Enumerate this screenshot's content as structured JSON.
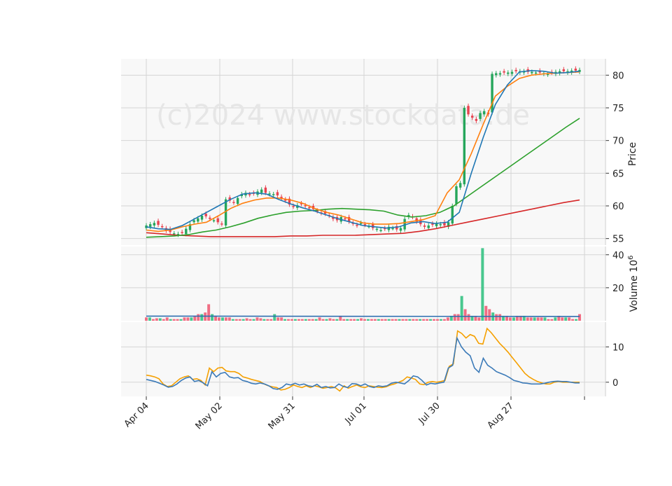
{
  "watermark": "(c)2024 www.stockdata.de",
  "x_tick_labels": [
    "Apr 04",
    "May 02",
    "May 31",
    "Jul 01",
    "Jul 30",
    "Aug 27"
  ],
  "chart_data": [
    {
      "type": "candlestick",
      "panel": "price",
      "ylabel": "Price",
      "ylim": [
        54,
        82.5
      ],
      "yticks": [
        55,
        60,
        65,
        70,
        75,
        80
      ],
      "grid": true,
      "colors": {
        "up": "#26a65b",
        "down": "#e8424f",
        "ma_fast": "#1f77b4",
        "ma_mid": "#ff7f0e",
        "ma_slow": "#2ca02c",
        "ma_long": "#d62728"
      },
      "candles_close": [
        57.0,
        57.2,
        57.4,
        57.1,
        56.8,
        56.2,
        56.0,
        55.8,
        55.7,
        55.9,
        56.5,
        57.2,
        57.8,
        58.1,
        58.5,
        58.4,
        58.0,
        57.8,
        57.5,
        57.2,
        61.0,
        60.8,
        60.5,
        61.2,
        61.8,
        62.0,
        61.7,
        61.9,
        62.2,
        62.5,
        62.0,
        61.9,
        61.8,
        61.6,
        61.2,
        60.8,
        60.2,
        59.9,
        60.1,
        60.3,
        60.0,
        59.7,
        59.5,
        59.2,
        58.9,
        58.8,
        58.5,
        58.0,
        57.8,
        58.3,
        58.0,
        57.6,
        57.3,
        57.0,
        57.4,
        57.1,
        56.9,
        56.6,
        56.5,
        56.3,
        56.5,
        56.8,
        56.6,
        56.4,
        56.6,
        58.0,
        58.6,
        58.3,
        57.6,
        57.2,
        56.8,
        57.0,
        57.1,
        57.3,
        57.2,
        57.0,
        57.5,
        60.0,
        63.0,
        63.5,
        75.0,
        74.0,
        73.5,
        73.0,
        74.2,
        74.5,
        74.0,
        80.2,
        80.3,
        80.3,
        80.4,
        80.4,
        80.5,
        80.6,
        80.6,
        80.6,
        80.5,
        80.5,
        80.4,
        80.4,
        80.3,
        80.2,
        80.4,
        80.5,
        80.6,
        80.6,
        80.6,
        80.7,
        80.7,
        80.8
      ],
      "ma_fast": [
        56.8,
        56.5,
        56.4,
        57.0,
        58.0,
        59.0,
        60.0,
        61.0,
        61.8,
        62.0,
        61.8,
        61.0,
        60.3,
        59.7,
        59.2,
        58.6,
        58.0,
        57.5,
        57.0,
        56.8,
        56.6,
        56.8,
        57.4,
        57.6,
        57.3,
        57.5,
        59.0,
        65.0,
        70.5,
        75.5,
        78.5,
        80.5,
        80.7,
        80.6,
        80.3,
        80.4,
        80.6
      ],
      "ma_mid": [
        56.3,
        56.1,
        56.3,
        56.8,
        57.2,
        57.5,
        58.5,
        59.6,
        60.4,
        60.9,
        61.2,
        61.2,
        60.9,
        60.4,
        59.6,
        59.0,
        58.6,
        58.0,
        57.4,
        57.2,
        57.2,
        57.3,
        57.6,
        57.9,
        58.5,
        62.0,
        64.0,
        68.0,
        72.5,
        76.8,
        78.3,
        79.5,
        80.0,
        80.2,
        80.3,
        80.4,
        80.5
      ],
      "ma_slow": [
        55.2,
        55.3,
        55.4,
        55.6,
        56.0,
        56.3,
        56.8,
        57.4,
        58.1,
        58.6,
        59.0,
        59.2,
        59.3,
        59.5,
        59.6,
        59.5,
        59.4,
        59.2,
        58.6,
        58.3,
        58.5,
        59.0,
        60.0,
        61.5,
        63.0,
        64.5,
        66.0,
        67.5,
        69.0,
        70.5,
        72.0,
        73.4
      ],
      "ma_long": [
        55.9,
        55.7,
        55.5,
        55.4,
        55.3,
        55.3,
        55.3,
        55.3,
        55.3,
        55.4,
        55.4,
        55.5,
        55.5,
        55.5,
        55.6,
        55.7,
        55.8,
        56.1,
        56.5,
        57.0,
        57.5,
        58.0,
        58.5,
        59.0,
        59.5,
        60.0,
        60.5,
        60.9
      ]
    },
    {
      "type": "bar",
      "panel": "volume",
      "ylabel": "Volume 10^6",
      "ylim": [
        0,
        45
      ],
      "yticks": [
        20,
        40
      ],
      "volumes": [
        2,
        2,
        1,
        1.5,
        1.5,
        1,
        2,
        1,
        1,
        1,
        1,
        2,
        2,
        2,
        3,
        4,
        4,
        5,
        10,
        4,
        3,
        2,
        2,
        2,
        2,
        1,
        1,
        1,
        1,
        1.5,
        1,
        1,
        2,
        1.5,
        1,
        1,
        1,
        4,
        2,
        2,
        1,
        1,
        1,
        1,
        1,
        1,
        1,
        1,
        1,
        1,
        2,
        1,
        1,
        1.5,
        1,
        1,
        3,
        1,
        1,
        1,
        1,
        1,
        1.5,
        1,
        1,
        1,
        1,
        1,
        1,
        1,
        1,
        1,
        1,
        1,
        1,
        1,
        1,
        1,
        1,
        1,
        1,
        1,
        1,
        1,
        1,
        1,
        1,
        2,
        3,
        4,
        4,
        15,
        7,
        4,
        3,
        3,
        2,
        44,
        9,
        7,
        5,
        4,
        4,
        3,
        3,
        2,
        2,
        3,
        3,
        3,
        2,
        2,
        2,
        2,
        2,
        2,
        1,
        1,
        2,
        3,
        2,
        2,
        2,
        1,
        1,
        4
      ],
      "avg_volume": 2.8
    },
    {
      "type": "line",
      "panel": "oscillator",
      "ylim": [
        -4,
        17
      ],
      "yticks": [
        0,
        10
      ],
      "series": [
        {
          "color": "#f5a000",
          "values": [
            2.0,
            1.8,
            1.5,
            1.0,
            -0.5,
            -1.2,
            -1.0,
            0.0,
            1.0,
            1.5,
            1.8,
            0.8,
            1.0,
            0.5,
            -0.8,
            4.0,
            3.0,
            4.0,
            4.2,
            3.2,
            3.0,
            3.0,
            2.5,
            1.5,
            1.2,
            0.8,
            0.5,
            0.2,
            -0.5,
            -1.0,
            -1.3,
            -1.5,
            -2.2,
            -2.0,
            -1.5,
            -0.8,
            -1.2,
            -1.5,
            -1.0,
            -1.5,
            -1.0,
            -1.3,
            -1.7,
            -1.5,
            -1.2,
            -1.6,
            -2.5,
            -1.0,
            -1.7,
            -1.2,
            -0.8,
            -1.3,
            -1.5,
            -1.0,
            -1.2,
            -1.4,
            -1.5,
            -1.3,
            -0.8,
            -0.5,
            0.0,
            0.5,
            1.5,
            1.2,
            0.8,
            -0.5,
            -0.7,
            0.0,
            0.2,
            0.0,
            0.2,
            0.5,
            4.5,
            5.2,
            14.5,
            13.8,
            12.5,
            13.5,
            13.0,
            11.0,
            10.8,
            15.2,
            14.0,
            12.5,
            11.0,
            9.8,
            8.5,
            7.0,
            5.5,
            4.0,
            2.5,
            1.5,
            0.8,
            0.2,
            -0.2,
            -0.5,
            -0.5,
            0.0,
            0.2,
            0.0,
            0.0,
            0.0,
            0.0,
            0.0
          ]
        },
        {
          "color": "#3b7ab8",
          "values": [
            0.8,
            0.5,
            0.2,
            -0.3,
            -0.8,
            -1.4,
            -1.2,
            -0.5,
            0.5,
            1.2,
            1.5,
            0.2,
            0.5,
            -0.2,
            -1.0,
            3.0,
            1.5,
            2.5,
            2.8,
            1.5,
            1.2,
            1.3,
            0.5,
            0.2,
            -0.3,
            -0.5,
            -0.2,
            -0.5,
            -1.0,
            -1.8,
            -2.0,
            -1.5,
            -0.5,
            -0.8,
            -0.3,
            -0.8,
            -0.5,
            -1.0,
            -1.2,
            -0.6,
            -1.5,
            -1.2,
            -1.6,
            -1.5,
            -0.5,
            -1.2,
            -1.5,
            -0.4,
            -0.5,
            -1.0,
            -0.5,
            -1.2,
            -1.5,
            -1.0,
            -1.2,
            -1.0,
            -0.3,
            0.0,
            -0.2,
            -0.5,
            0.5,
            1.8,
            1.5,
            0.5,
            -0.8,
            -0.3,
            -0.5,
            -0.2,
            0.0,
            4.0,
            4.8,
            12.5,
            10.0,
            8.5,
            7.5,
            4.0,
            2.8,
            6.8,
            4.8,
            4.0,
            3.0,
            2.5,
            2.0,
            1.3,
            0.5,
            0.2,
            -0.2,
            -0.3,
            -0.5,
            -0.5,
            -0.5,
            -0.3,
            0.0,
            0.2,
            0.3,
            0.2,
            0.2,
            0.0,
            -0.2,
            -0.2
          ]
        }
      ]
    }
  ]
}
